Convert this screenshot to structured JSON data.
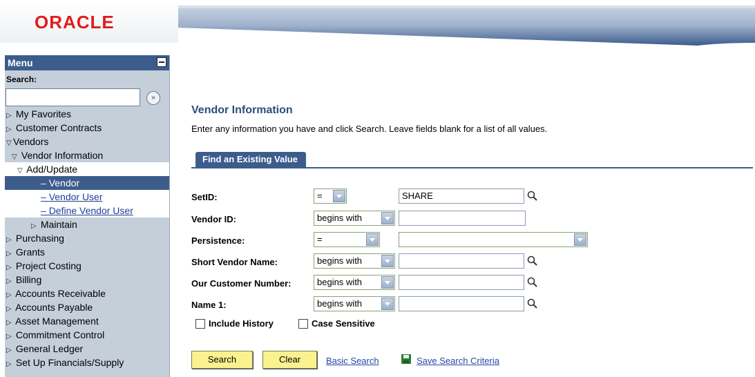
{
  "brand": {
    "logo_text": "ORACLE",
    "accent": "#3c5c8c",
    "logo_color": "#e11c1c"
  },
  "menu": {
    "title": "Menu",
    "search_label": "Search:",
    "search_value": "",
    "items": [
      {
        "label": "My Favorites",
        "state": "collapsed"
      },
      {
        "label": "Customer Contracts",
        "state": "collapsed"
      },
      {
        "label": "Vendors",
        "state": "expanded"
      },
      {
        "label": "Vendor Information",
        "state": "expanded"
      },
      {
        "label": "Add/Update",
        "state": "expanded"
      },
      {
        "label": "Vendor",
        "state": "selected"
      },
      {
        "label": "Vendor User",
        "state": "link"
      },
      {
        "label": "Define Vendor User",
        "state": "link"
      },
      {
        "label": "Maintain",
        "state": "collapsed"
      },
      {
        "label": "Purchasing",
        "state": "collapsed"
      },
      {
        "label": "Grants",
        "state": "collapsed"
      },
      {
        "label": "Project Costing",
        "state": "collapsed"
      },
      {
        "label": "Billing",
        "state": "collapsed"
      },
      {
        "label": "Accounts Receivable",
        "state": "collapsed"
      },
      {
        "label": "Accounts Payable",
        "state": "collapsed"
      },
      {
        "label": "Asset Management",
        "state": "collapsed"
      },
      {
        "label": "Commitment Control",
        "state": "collapsed"
      },
      {
        "label": "General Ledger",
        "state": "collapsed"
      },
      {
        "label": "Set Up Financials/Supply",
        "state": "collapsed"
      }
    ]
  },
  "page": {
    "title": "Vendor Information",
    "instructions": "Enter any information you have and click Search. Leave fields blank for a list of all values.",
    "tab_label": "Find an Existing Value"
  },
  "fields": [
    {
      "label": "SetID:",
      "operator": "=",
      "value": "SHARE"
    },
    {
      "label": "Vendor ID:",
      "operator": "begins with",
      "value": ""
    },
    {
      "label": "Persistence:",
      "operator": "=",
      "value": ""
    },
    {
      "label": "Short Vendor Name:",
      "operator": "begins with",
      "value": ""
    },
    {
      "label": "Our Customer Number:",
      "operator": "begins with",
      "value": ""
    },
    {
      "label": "Name 1:",
      "operator": "begins with",
      "value": ""
    }
  ],
  "options": {
    "include_history": {
      "label": "Include History",
      "checked": false
    },
    "case_sensitive": {
      "label": "Case Sensitive",
      "checked": false
    }
  },
  "actions": {
    "search": "Search",
    "clear": "Clear",
    "basic_search": "Basic Search",
    "save_criteria": "Save Search Criteria"
  }
}
